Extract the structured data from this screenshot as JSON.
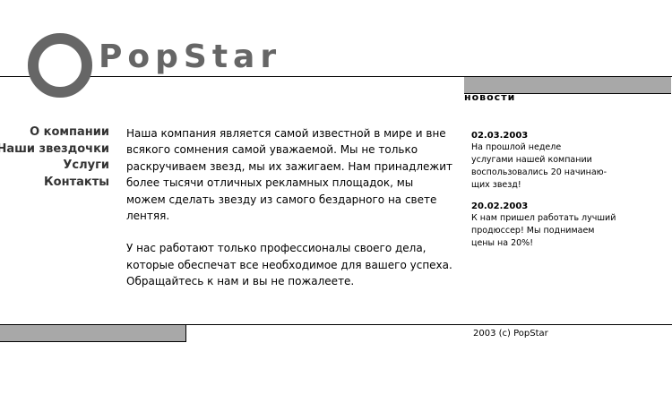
{
  "header": {
    "brand": "PopStar",
    "logo_icon": "ring-logo-icon"
  },
  "nav": {
    "items": [
      {
        "label": "О компании"
      },
      {
        "label": "Наши звездочки"
      },
      {
        "label": "Услуги"
      },
      {
        "label": "Контакты"
      }
    ]
  },
  "main": {
    "paragraphs": [
      "Наша компания является самой известной в мире и вне всякого сомнения самой уважаемой. Мы не только раскручиваем звезд, мы их зажигаем. Нам принадлежит более тысячи отличных рекламных площадок, мы можем сделать звезду из самого бездарного на свете лентяя.",
      "У нас работают только профессионалы своего дела, которые обеспечат все необходимое для вашего успеха. Обращайтесь к нам и вы не пожалеете."
    ]
  },
  "news": {
    "heading": "новости",
    "items": [
      {
        "date": "02.03.2003",
        "text": "На прошлой неделе\nуслугами нашей компании\nвоспользовались 20 начинаю-\nщих звезд!"
      },
      {
        "date": "20.02.2003",
        "text": "К нам пришел работать лучший\nпродюссер! Мы поднимаем\nцены на 20%!"
      }
    ]
  },
  "footer": {
    "copyright": "2003 (c) PopStar"
  },
  "colors": {
    "brand_gray": "#666666",
    "bar_gray": "#a8a8a8",
    "nav_text": "#333333"
  }
}
